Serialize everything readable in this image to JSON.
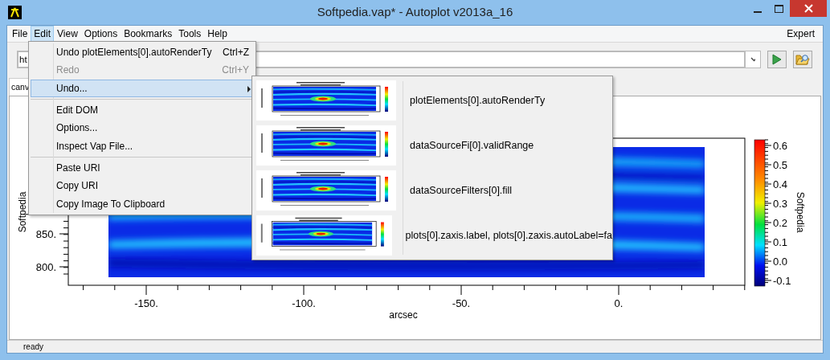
{
  "window": {
    "title": "Softpedia.vap* - Autoplot v2013a_16"
  },
  "menu_bar": {
    "items": [
      {
        "label": "File",
        "selected": false
      },
      {
        "label": "Edit",
        "selected": true
      },
      {
        "label": "View",
        "selected": false
      },
      {
        "label": "Options",
        "selected": false
      },
      {
        "label": "Bookmarks",
        "selected": false
      },
      {
        "label": "Tools",
        "selected": false
      },
      {
        "label": "Help",
        "selected": false
      }
    ],
    "right_label": "Expert"
  },
  "url_field": {
    "value": "ht"
  },
  "tabs": [
    {
      "label": "canv",
      "selected": true
    }
  ],
  "plot": {
    "ylabel": "Softpedia",
    "yticks": [
      "850.",
      "800."
    ],
    "xticks": [
      "-150.",
      "-100.",
      "-50.",
      "0."
    ],
    "xlabel": "arcsec",
    "colorbar": {
      "label": "Softpedia",
      "ticks": [
        "0.6",
        "0.5",
        "0.4",
        "0.3",
        "0.2",
        "0.1",
        "0.0",
        "-0.1"
      ]
    }
  },
  "edit_menu": {
    "items": [
      {
        "kind": "item",
        "label": "Undo plotElements[0].autoRenderTy",
        "shortcut": "Ctrl+Z",
        "disabled": false,
        "selected": false
      },
      {
        "kind": "item",
        "label": "Redo",
        "shortcut": "Ctrl+Y",
        "disabled": true,
        "selected": false
      },
      {
        "kind": "submenu",
        "label": "Undo...",
        "disabled": false,
        "selected": true
      },
      {
        "kind": "separator"
      },
      {
        "kind": "item",
        "label": "Edit DOM",
        "disabled": false,
        "selected": false
      },
      {
        "kind": "item",
        "label": "Options...",
        "disabled": false,
        "selected": false
      },
      {
        "kind": "item",
        "label": "Inspect Vap File...",
        "disabled": false,
        "selected": false
      },
      {
        "kind": "separator"
      },
      {
        "kind": "item",
        "label": "Paste URI",
        "disabled": false,
        "selected": false
      },
      {
        "kind": "item",
        "label": "Copy URI",
        "disabled": false,
        "selected": false
      },
      {
        "kind": "item",
        "label": "Copy Image To Clipboard",
        "disabled": false,
        "selected": false
      }
    ]
  },
  "undo_submenu": {
    "items": [
      {
        "label": "plotElements[0].autoRenderTy"
      },
      {
        "label": "dataSourceFi[0].validRange"
      },
      {
        "label": "dataSourceFilters[0].fill"
      },
      {
        "label": "plots[0].zaxis.label, plots[0].zaxis.autoLabel=fa"
      }
    ]
  },
  "status_bar": {
    "text": "ready"
  }
}
